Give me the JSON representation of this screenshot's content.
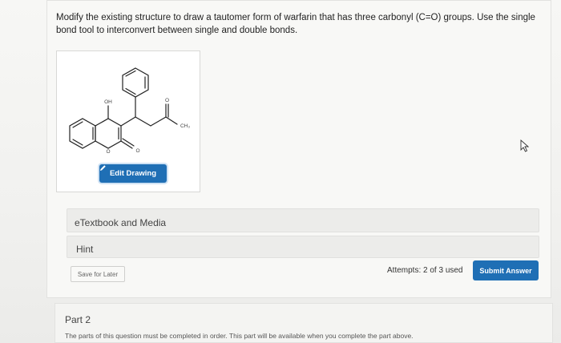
{
  "question": {
    "text": "Modify the existing structure to draw a tautomer form of warfarin that has three carbonyl (C=O) groups. Use the single bond tool to interconvert between single and double bonds."
  },
  "drawing": {
    "labels": {
      "oh": "OH",
      "o_ketone": "O",
      "ch3": "CH₃",
      "o_ring": "O",
      "o_lactone": "O"
    },
    "edit_button": "Edit Drawing"
  },
  "panels": {
    "etextbook": "eTextbook and Media",
    "hint": "Hint"
  },
  "footer": {
    "save_label": "Save for Later",
    "attempts": "Attempts: 2 of 3 used",
    "submit_label": "Submit Answer"
  },
  "part2": {
    "title": "Part 2",
    "message": "The parts of this question must be completed in order. This part will be available when you complete the part above."
  },
  "colors": {
    "primary_button": "#1f6fb5"
  },
  "icons": {
    "edit": "pencil-icon",
    "cursor": "mouse-pointer-icon"
  }
}
